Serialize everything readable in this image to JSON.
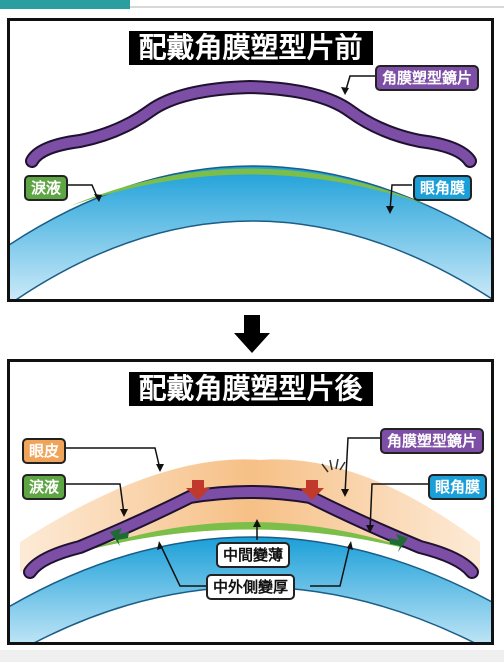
{
  "panel_before": {
    "title": "配戴角膜塑型片前",
    "labels": {
      "lens": "角膜塑型鏡片",
      "tear": "淚液",
      "cornea": "眼角膜"
    }
  },
  "panel_after": {
    "title": "配戴角膜塑型片後",
    "labels": {
      "eyelid": "眼皮",
      "tear": "淚液",
      "lens": "角膜塑型鏡片",
      "cornea": "眼角膜",
      "center_thinning": "中間變薄",
      "periphery_thickening": "中外側變厚"
    }
  },
  "colors": {
    "lens": "#7d4ea5",
    "tear": "#7bbf4a",
    "cornea": "#1b9fd8",
    "eyelid": "#f5b978",
    "pressure_arrow": "#c0392b",
    "flow_arrow": "#1e6b34",
    "accent_bar": "#2a9fa0"
  },
  "icons": {
    "transition": "down-arrow-icon",
    "pressure": "red-down-arrow-icon",
    "flow": "green-side-arrow-icon"
  }
}
